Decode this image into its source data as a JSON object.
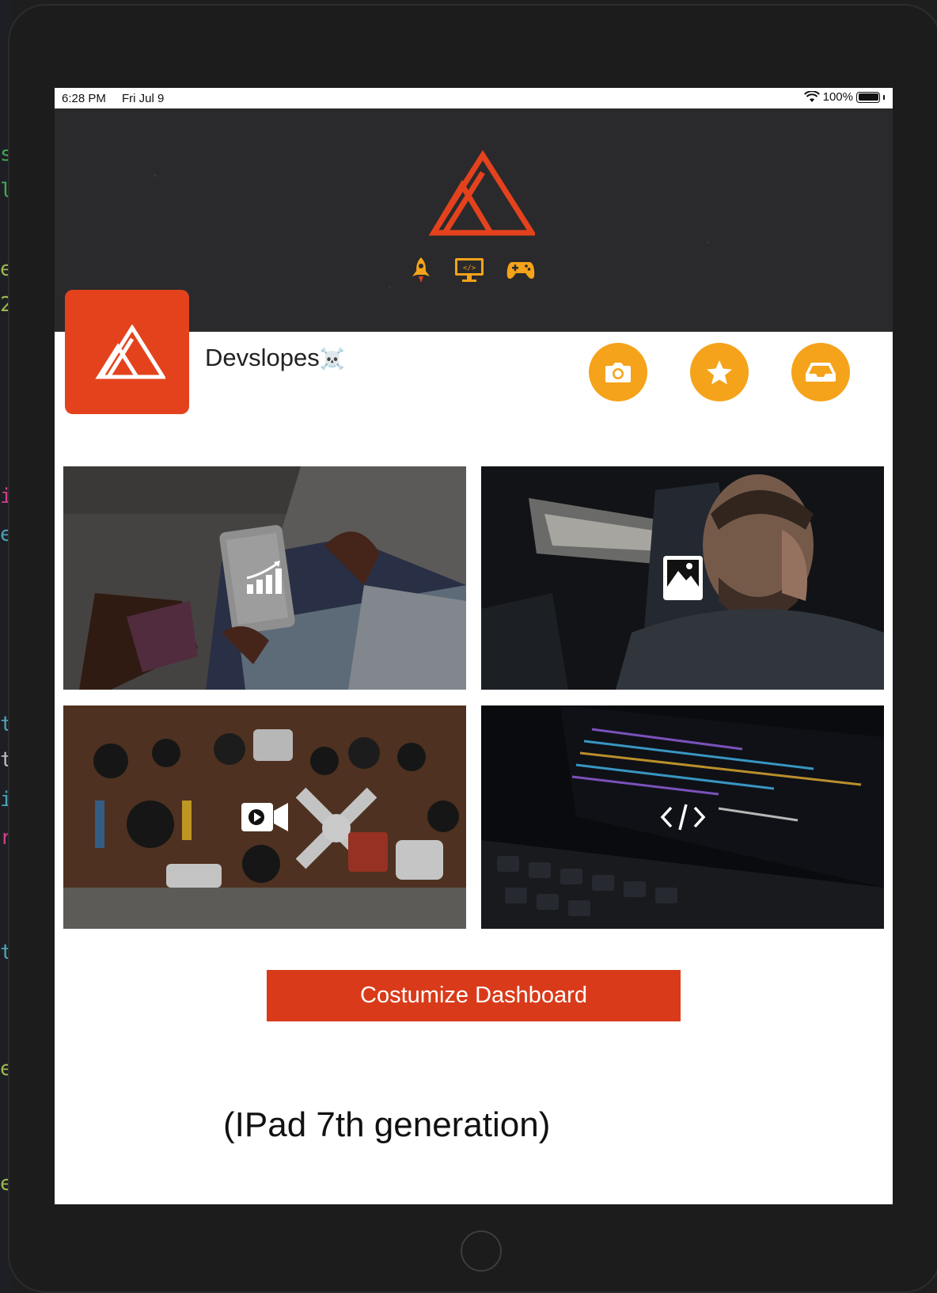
{
  "status_bar": {
    "time": "6:28 PM",
    "date": "Fri Jul 9",
    "battery": "100%"
  },
  "header": {
    "logo_icon": "mountain-logo-icon",
    "icons": [
      "rocket-icon",
      "monitor-code-icon",
      "gamepad-icon"
    ]
  },
  "profile": {
    "name": "Devslopes",
    "emoji": "☠️"
  },
  "actions": [
    {
      "icon": "camera-icon"
    },
    {
      "icon": "star-icon"
    },
    {
      "icon": "inbox-icon"
    }
  ],
  "tiles": [
    {
      "icon": "chart-icon"
    },
    {
      "icon": "image-icon"
    },
    {
      "icon": "video-icon"
    },
    {
      "icon": "code-icon"
    }
  ],
  "customize_button": "Costumize Dashboard",
  "caption": "(IPad 7th generation)",
  "colors": {
    "accent": "#e4421d",
    "button": "#d93b1a",
    "action_circle": "#f5a31a",
    "header_bg": "#2a2a2c"
  }
}
